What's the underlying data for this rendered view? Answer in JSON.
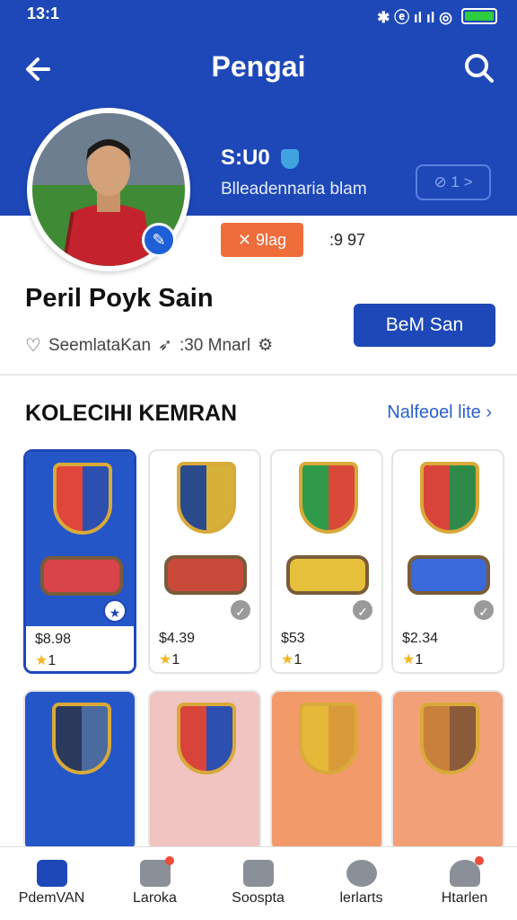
{
  "status_bar": {
    "time": "13:1",
    "glyphs": "✱ ⓔ ıl ıl ◎"
  },
  "header": {
    "title": "Pengai"
  },
  "profile": {
    "stat": "S:U0",
    "subtitle": "Blleadennaria blam",
    "outline_button": "⊘ 1 >",
    "tag_orange": "✕ 9lag",
    "tag_plain": ":9 97",
    "name": "Peril Poyk Sain",
    "primary_button": "BeM San",
    "meta_text": "SeemlataKan",
    "meta_count": ":30 Mnarl"
  },
  "section": {
    "title": "KOLECIHI KEMRAN",
    "link": "Nalfeoel lite"
  },
  "cards": [
    {
      "price": "$8.98",
      "rating": "1",
      "bg": "#2456c8",
      "shield_a": "#e0463a",
      "shield_b": "#2d4fb0",
      "belt": "#d9444a"
    },
    {
      "price": "$4.39",
      "rating": "1",
      "bg": "#ffffff",
      "shield_a": "#2a4a8c",
      "shield_b": "#d6b13a",
      "belt": "#c94a3a"
    },
    {
      "price": "$53",
      "rating": "1",
      "bg": "#ffffff",
      "shield_a": "#2f9a4a",
      "shield_b": "#d9493a",
      "belt": "#e6c03a"
    },
    {
      "price": "$2.34",
      "rating": "1",
      "bg": "#ffffff",
      "shield_a": "#d9443a",
      "shield_b": "#2f8a4a",
      "belt": "#3a6ad9"
    }
  ],
  "cards_row2": [
    {
      "bg": "#2456c8",
      "shield_a": "#2a3a5c",
      "shield_b": "#4a6aa0"
    },
    {
      "bg": "#f0c4c0",
      "shield_a": "#d9443a",
      "shield_b": "#2d4fb0"
    },
    {
      "bg": "#f29a6a",
      "shield_a": "#e6b83a",
      "shield_b": "#d99a3a"
    },
    {
      "bg": "#f2a078",
      "shield_a": "#c9803a",
      "shield_b": "#8a5a3a"
    }
  ],
  "nav": [
    {
      "label": "PdemVAN"
    },
    {
      "label": "Laroka"
    },
    {
      "label": "Soospta"
    },
    {
      "label": "lerlarts"
    },
    {
      "label": "Htarlen"
    }
  ]
}
